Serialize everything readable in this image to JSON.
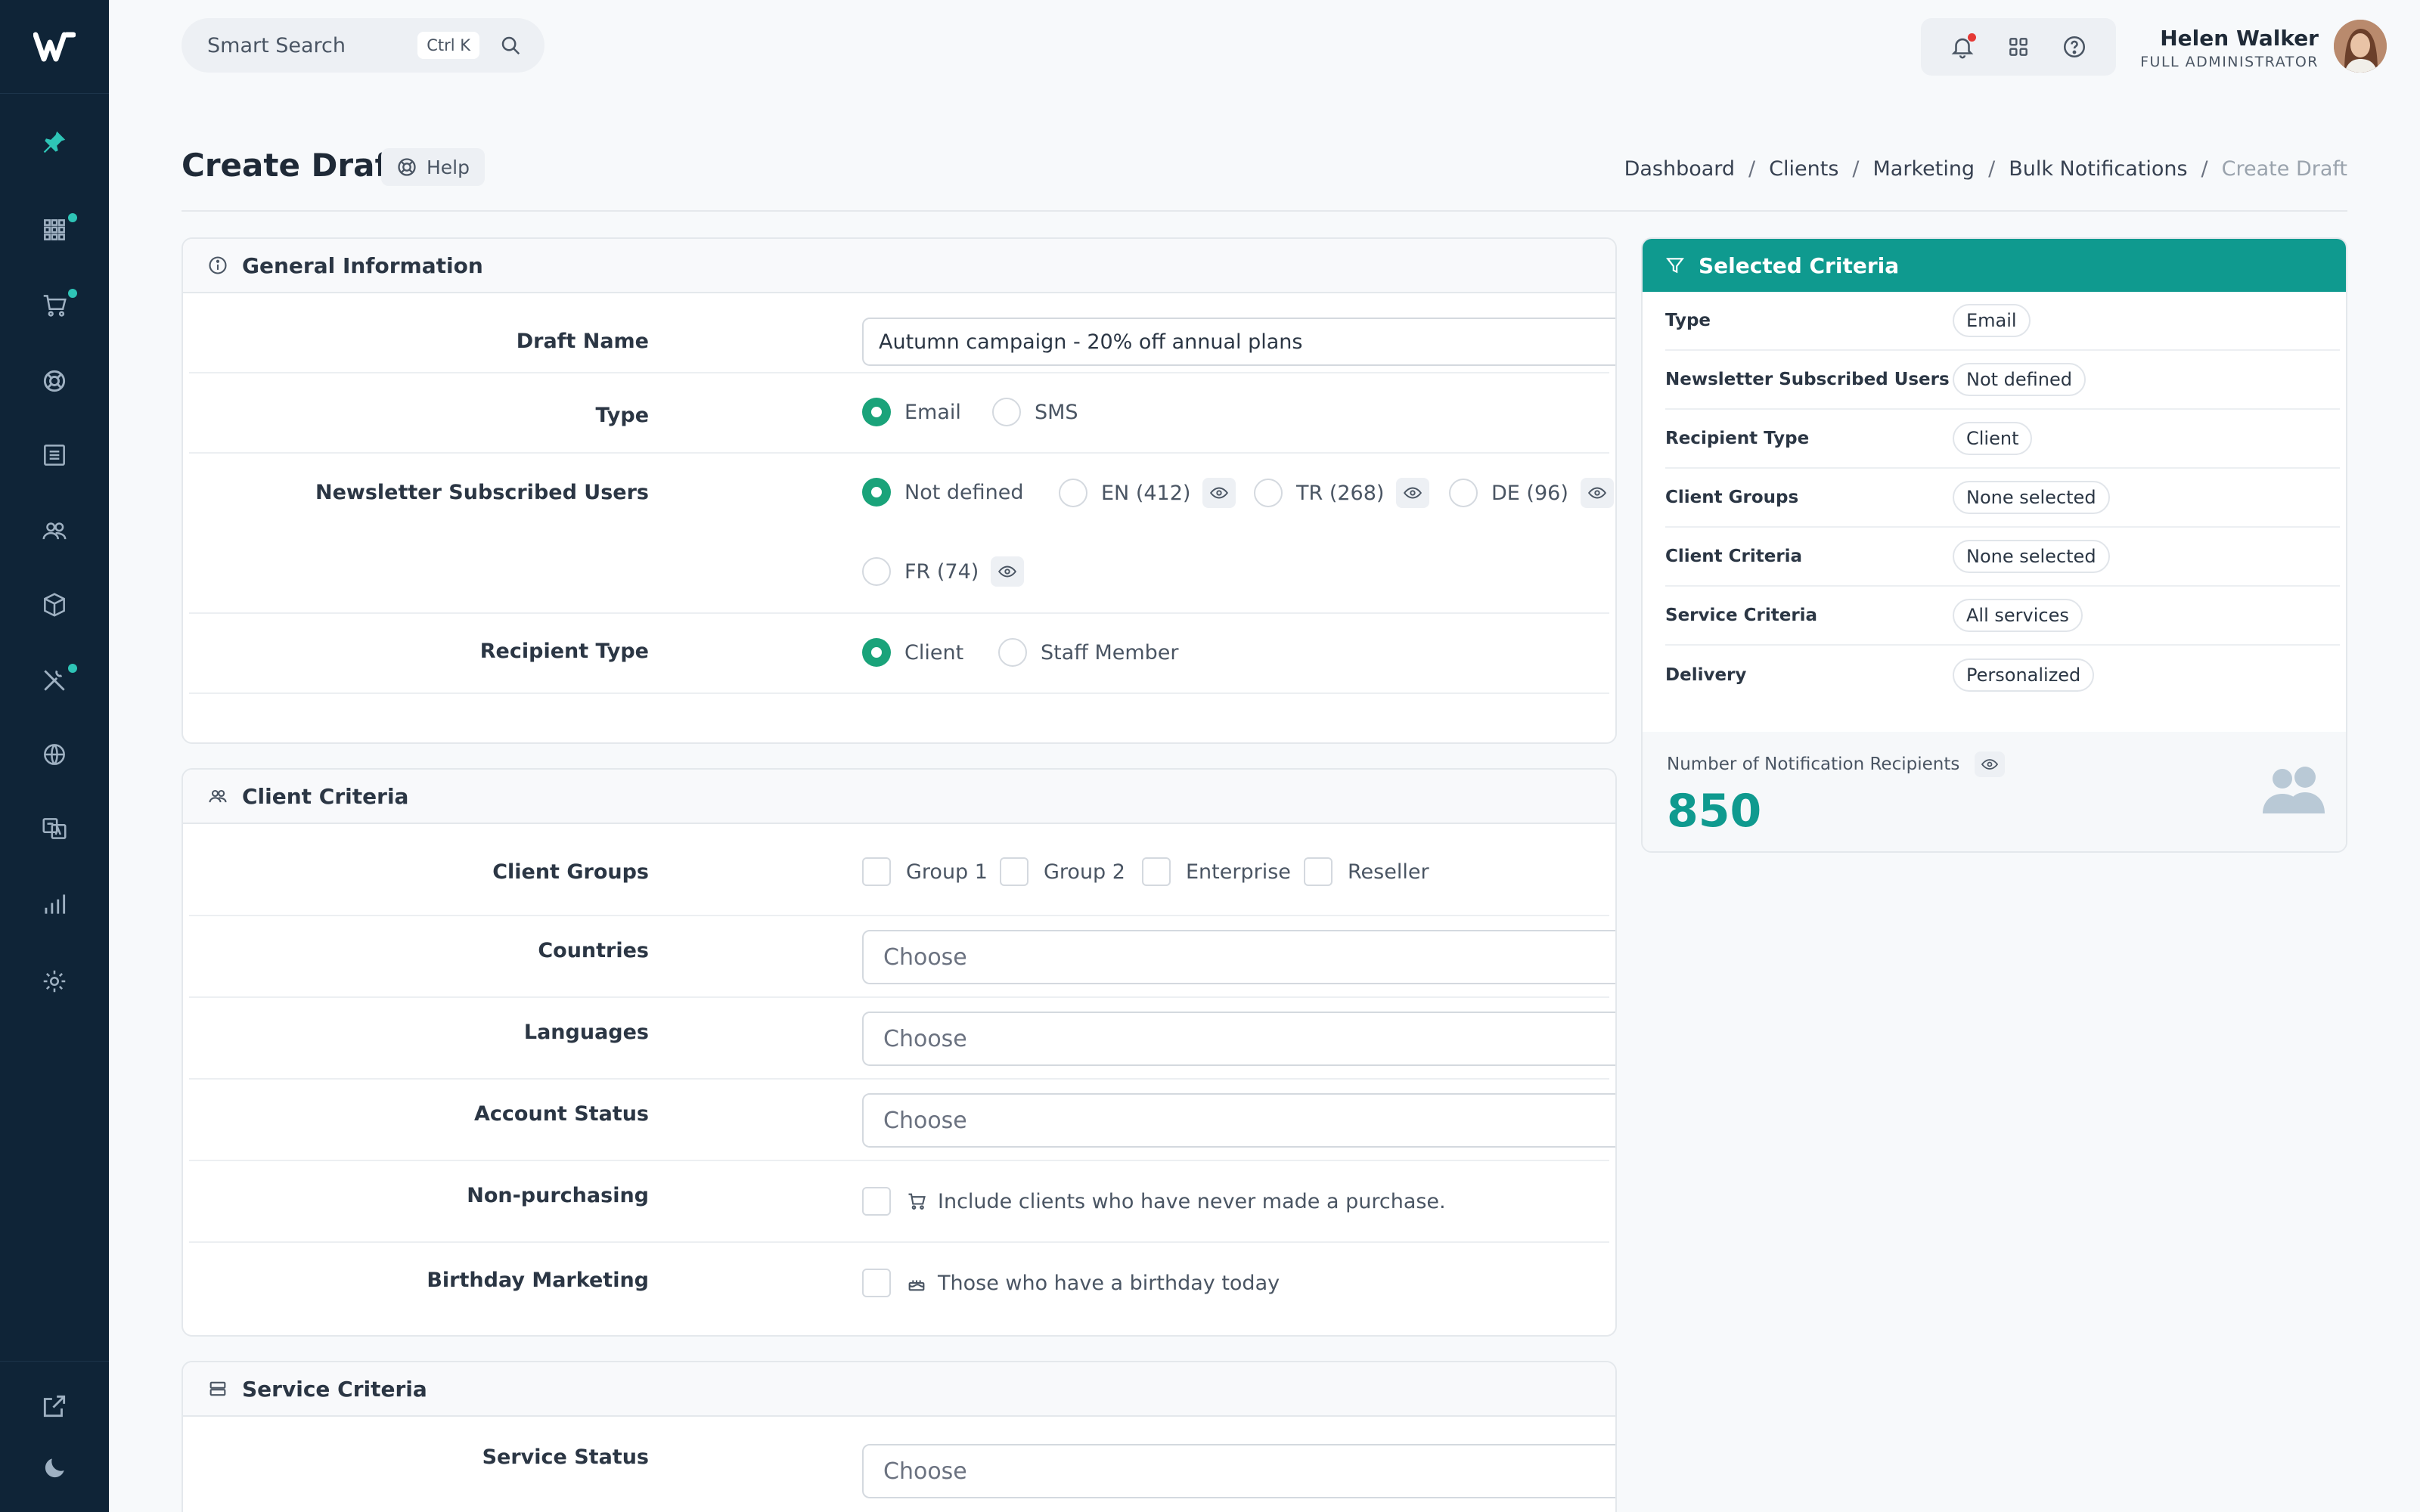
{
  "header": {
    "search_label": "Smart Search",
    "search_shortcut": "Ctrl K",
    "user_name": "Helen Walker",
    "user_role": "FULL ADMINISTRATOR"
  },
  "page": {
    "title": "Create Draft",
    "help_label": "Help",
    "breadcrumb": [
      "Dashboard",
      "Clients",
      "Marketing",
      "Bulk Notifications",
      "Create Draft"
    ]
  },
  "general": {
    "title": "General Information",
    "draft_name_label": "Draft Name",
    "draft_name_value": "Autumn campaign - 20% off annual plans",
    "type_label": "Type",
    "type_options": [
      "Email",
      "SMS"
    ],
    "newsletter_label": "Newsletter Subscribed Users",
    "newsletter_options": [
      "Not defined",
      "EN (412)",
      "TR (268)",
      "DE (96)",
      "FR (74)"
    ],
    "recipient_label": "Recipient Type",
    "recipient_options": [
      "Client",
      "Staff Member"
    ]
  },
  "client_criteria": {
    "title": "Client Criteria",
    "groups_label": "Client Groups",
    "groups": [
      "Group 1",
      "Group 2",
      "Enterprise",
      "Reseller"
    ],
    "countries_label": "Countries",
    "languages_label": "Languages",
    "account_status_label": "Account Status",
    "choose": "Choose",
    "non_purchasing_label": "Non-purchasing",
    "non_purchasing_text": "Include clients who have never made a purchase.",
    "birthday_label": "Birthday Marketing",
    "birthday_text": "Those who have a birthday today"
  },
  "service_criteria": {
    "title": "Service Criteria",
    "service_status_label": "Service Status",
    "choose": "Choose"
  },
  "selected": {
    "title": "Selected Criteria",
    "rows": [
      {
        "label": "Type",
        "value": "Email"
      },
      {
        "label": "Newsletter Subscribed Users",
        "value": "Not defined"
      },
      {
        "label": "Recipient Type",
        "value": "Client"
      },
      {
        "label": "Client Groups",
        "value": "None selected"
      },
      {
        "label": "Client Criteria",
        "value": "None selected"
      },
      {
        "label": "Service Criteria",
        "value": "All services"
      },
      {
        "label": "Delivery",
        "value": "Personalized"
      }
    ],
    "recipients_label": "Number of Notification Recipients",
    "recipients_count": "850"
  },
  "colors": {
    "sidebar": "#0f2437",
    "accent": "#0f9a8f",
    "radio_on": "#1aa37a",
    "nav_dot": "#2ec4b6",
    "alert": "#e53935"
  }
}
